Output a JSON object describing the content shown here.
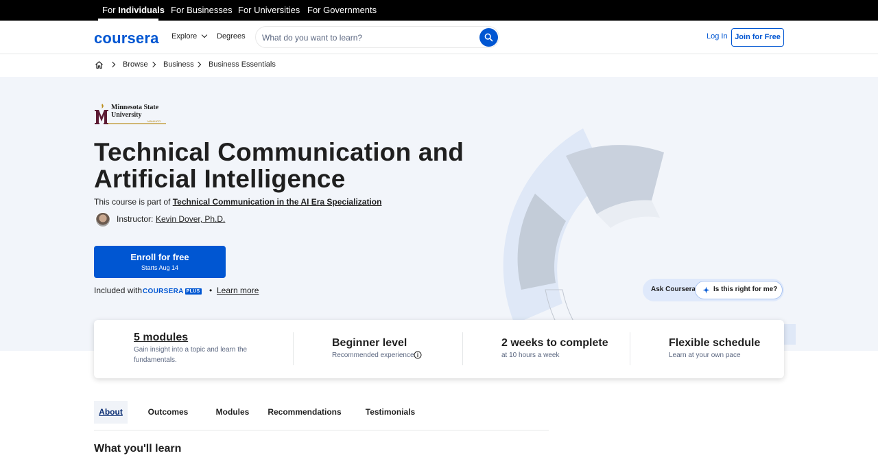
{
  "audience_bar": {
    "tabs": [
      {
        "prefix": "For ",
        "label": "Individuals"
      },
      {
        "label": "For Businesses"
      },
      {
        "label": "For Universities"
      },
      {
        "label": "For Governments"
      }
    ]
  },
  "header": {
    "logo": "coursera",
    "explore": "Explore",
    "degrees": "Degrees",
    "search_placeholder": "What do you want to learn?",
    "login": "Log In",
    "join": "Join for Free"
  },
  "breadcrumb": [
    "Browse",
    "Business",
    "Business Essentials"
  ],
  "hero": {
    "university_line1": "Minnesota State",
    "university_line2": "University",
    "university_tag": "MANKATO",
    "title": "Technical Communication and Artificial Intelligence",
    "part_of_prefix": "This course is part of ",
    "specialization": "Technical Communication in the AI Era Specialization",
    "instructor_label": "Instructor:",
    "instructor_name": "Kevin Dover, Ph.D.",
    "enroll_label": "Enroll for free",
    "enroll_sub": "Starts Aug 14",
    "included_with": "Included with",
    "plus_logo": "COURSERA",
    "plus_badge": "PLUS",
    "bullet": "•",
    "learn_more": "Learn more",
    "ask_label": "Ask Coursera",
    "ask_button": "Is this right for me?"
  },
  "info_card": {
    "modules_title": "5 modules",
    "modules_sub": "Gain insight into a topic and learn the fundamentals.",
    "level_title": "Beginner level",
    "level_sub": "Recommended experience",
    "duration_title": "2 weeks to complete",
    "duration_sub": "at 10 hours a week",
    "schedule_title": "Flexible schedule",
    "schedule_sub": "Learn at your own pace"
  },
  "tabs": [
    "About",
    "Outcomes",
    "Modules",
    "Recommendations",
    "Testimonials"
  ],
  "section_heading": "What you'll learn",
  "colors": {
    "brand_blue": "#0056d2",
    "hero_bg": "#f2f5fa",
    "gold": "#b98c1a"
  },
  "icons": [
    "home-icon",
    "chevron-right-icon",
    "chevron-down-icon",
    "search-icon",
    "info-icon",
    "sparkle-icon"
  ]
}
